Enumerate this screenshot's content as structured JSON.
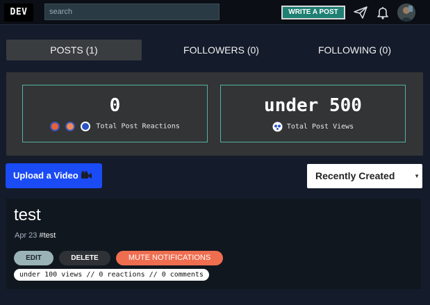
{
  "header": {
    "logo_text": "DEV",
    "search_placeholder": "search",
    "write_post_label": "WRITE A POST",
    "icons": [
      "send-icon",
      "bell-icon",
      "avatar"
    ]
  },
  "tabs": [
    {
      "label": "POSTS (1)",
      "active": true
    },
    {
      "label": "FOLLOWERS (0)",
      "active": false
    },
    {
      "label": "FOLLOWING (0)",
      "active": false
    }
  ],
  "stats": {
    "reactions": {
      "value": "0",
      "label": "Total Post Reactions"
    },
    "views": {
      "value": "under 500",
      "label": "Total Post Views"
    }
  },
  "actions": {
    "upload_label": "Upload a Video",
    "sort_selected": "Recently Created"
  },
  "post": {
    "title": "test",
    "date": "Apr 23",
    "tag": "#test",
    "edit_label": "EDIT",
    "delete_label": "DELETE",
    "mute_label": "MUTE NOTIFICATIONS",
    "stats_text": "under 100 views // 0 reactions // 0 comments"
  },
  "colors": {
    "background": "#141b2b",
    "accent_teal": "#1e7f72",
    "upload_blue": "#1a4bf5",
    "mute_orange": "#ef6e50",
    "stat_border": "#56b3a3"
  }
}
